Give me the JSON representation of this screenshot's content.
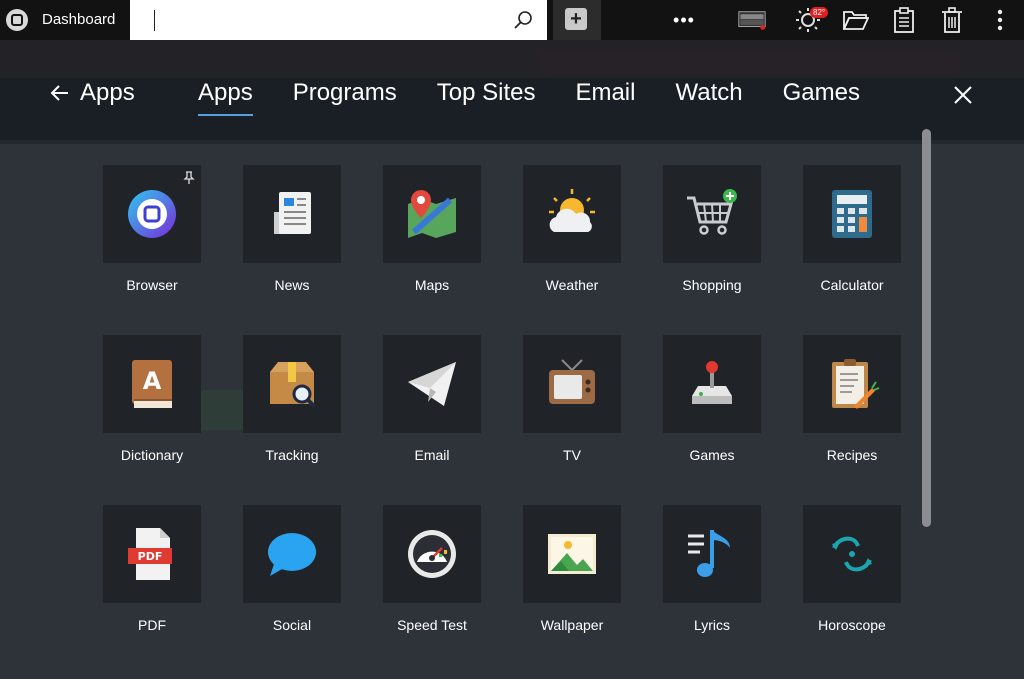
{
  "topbar": {
    "title": "Dashboard",
    "search_value": "",
    "new_tab_label": "+",
    "more_label": "•••",
    "notification_badge": "82°"
  },
  "nav": {
    "back_label": "Apps",
    "tabs": [
      {
        "label": "Apps",
        "active": true
      },
      {
        "label": "Programs",
        "active": false
      },
      {
        "label": "Top Sites",
        "active": false
      },
      {
        "label": "Email",
        "active": false
      },
      {
        "label": "Watch",
        "active": false
      },
      {
        "label": "Games",
        "active": false
      }
    ]
  },
  "apps": [
    {
      "label": "Browser",
      "icon": "browser-icon"
    },
    {
      "label": "News",
      "icon": "news-icon"
    },
    {
      "label": "Maps",
      "icon": "maps-icon"
    },
    {
      "label": "Weather",
      "icon": "weather-icon"
    },
    {
      "label": "Shopping",
      "icon": "shopping-cart-icon"
    },
    {
      "label": "Calculator",
      "icon": "calculator-icon"
    },
    {
      "label": "Dictionary",
      "icon": "dictionary-icon"
    },
    {
      "label": "Tracking",
      "icon": "package-tracking-icon"
    },
    {
      "label": "Email",
      "icon": "paper-plane-icon"
    },
    {
      "label": "TV",
      "icon": "tv-icon"
    },
    {
      "label": "Games",
      "icon": "joystick-icon"
    },
    {
      "label": "Recipes",
      "icon": "recipe-clipboard-icon"
    },
    {
      "label": "PDF",
      "icon": "pdf-icon"
    },
    {
      "label": "Social",
      "icon": "chat-bubble-icon"
    },
    {
      "label": "Speed Test",
      "icon": "speedometer-icon"
    },
    {
      "label": "Wallpaper",
      "icon": "picture-icon"
    },
    {
      "label": "Lyrics",
      "icon": "music-note-icon"
    },
    {
      "label": "Horoscope",
      "icon": "pisces-icon"
    }
  ]
}
